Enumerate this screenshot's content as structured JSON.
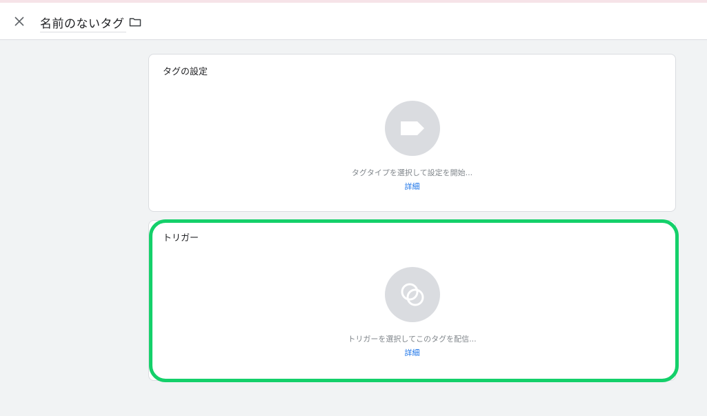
{
  "header": {
    "close_icon": "close-icon",
    "title": "名前のないタグ",
    "folder_icon": "folder-icon"
  },
  "tag_card": {
    "title": "タグの設定",
    "icon": "tag-icon",
    "hint": "タグタイプを選択して設定を開始...",
    "link": "詳細"
  },
  "trigger_card": {
    "title": "トリガー",
    "icon": "trigger-icon",
    "hint": "トリガーを選択してこのタグを配信...",
    "link": "詳細"
  },
  "colors": {
    "highlight": "#14d06a",
    "link": "#1a73e8",
    "icon_circle": "#dadce0",
    "background": "#f1f3f4"
  }
}
